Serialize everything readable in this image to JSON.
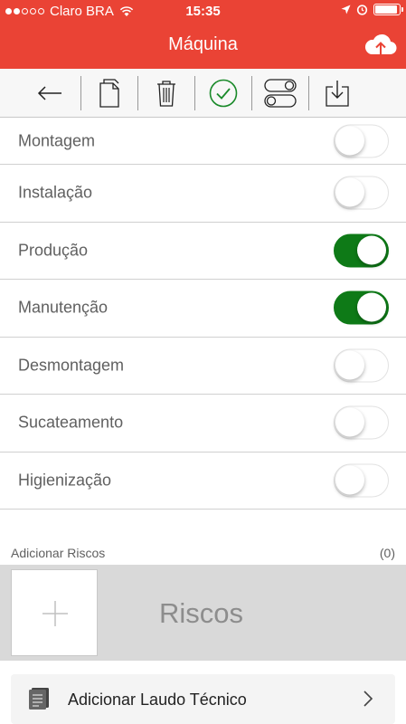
{
  "statusbar": {
    "carrier": "Claro BRA",
    "time": "15:35",
    "signal_bars_filled": 2,
    "signal_bars_total": 5
  },
  "navbar": {
    "title": "Máquina",
    "upload_icon": "cloud-upload-icon"
  },
  "toolbar": {
    "items": [
      "back-arrow-icon",
      "copy-document-icon",
      "trash-icon",
      "check-circle-icon",
      "toggles-icon",
      "download-tray-icon"
    ]
  },
  "phases": [
    {
      "label": "Montagem",
      "on": false
    },
    {
      "label": "Instalação",
      "on": false
    },
    {
      "label": "Produção",
      "on": true
    },
    {
      "label": "Manutenção",
      "on": true
    },
    {
      "label": "Desmontagem",
      "on": false
    },
    {
      "label": "Sucateamento",
      "on": false
    },
    {
      "label": "Higienização",
      "on": false
    }
  ],
  "riscos": {
    "header": "Adicionar Riscos",
    "count": "(0)",
    "label": "Riscos"
  },
  "laudo": {
    "label": "Adicionar Laudo Técnico"
  },
  "colors": {
    "brand_red": "#ea4335",
    "toggle_on": "#0e7a17",
    "check_green": "#1a8a2a"
  }
}
